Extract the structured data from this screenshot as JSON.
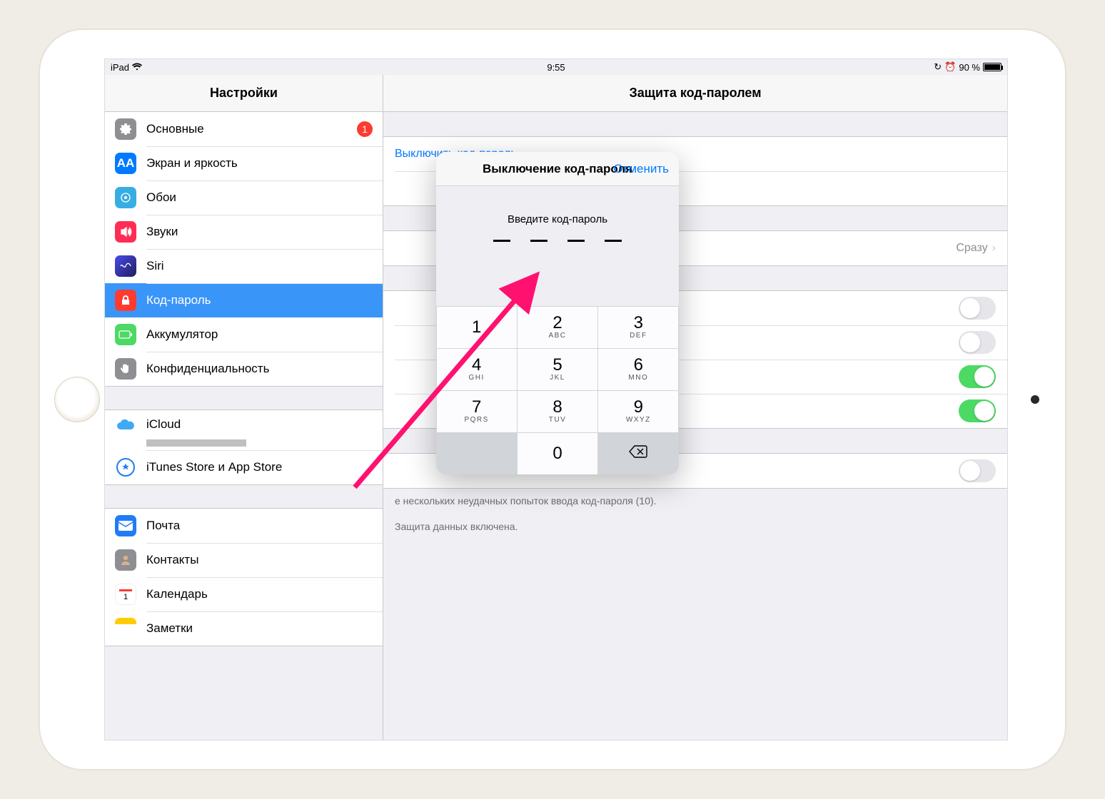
{
  "status": {
    "device": "iPad",
    "time": "9:55",
    "battery_pct": "90 %"
  },
  "titles": {
    "sidebar": "Настройки",
    "detail": "Защита код-паролем"
  },
  "sidebar": {
    "g1": [
      {
        "label": "Основные",
        "icon": "general",
        "badge": "1"
      },
      {
        "label": "Экран и яркость",
        "icon": "display"
      },
      {
        "label": "Обои",
        "icon": "wall"
      },
      {
        "label": "Звуки",
        "icon": "sound"
      },
      {
        "label": "Siri",
        "icon": "siri"
      },
      {
        "label": "Код-пароль",
        "icon": "pass",
        "selected": true
      },
      {
        "label": "Аккумулятор",
        "icon": "batt"
      },
      {
        "label": "Конфиденциальность",
        "icon": "priv"
      }
    ],
    "g2": [
      {
        "label": "iCloud",
        "icon": "icloud"
      },
      {
        "label": "iTunes Store и App Store",
        "icon": "itunes"
      }
    ],
    "g3": [
      {
        "label": "Почта",
        "icon": "mail"
      },
      {
        "label": "Контакты",
        "icon": "contacts"
      },
      {
        "label": "Календарь",
        "icon": "cal"
      },
      {
        "label": "Заметки",
        "icon": "notes"
      }
    ]
  },
  "detail": {
    "turn_off": "Выключить код-пароль",
    "require_value": "Сразу",
    "footer_erase": "e нескольких неудачных попыток ввода код-пароля (10).",
    "footer_protect": "Защита данных включена."
  },
  "popover": {
    "title": "Выключение код-пароля",
    "cancel": "Отменить",
    "prompt": "Введите код-пароль",
    "keys": [
      [
        "1",
        ""
      ],
      [
        "2",
        "ABC"
      ],
      [
        "3",
        "DEF"
      ],
      [
        "4",
        "GHI"
      ],
      [
        "5",
        "JKL"
      ],
      [
        "6",
        "MNO"
      ],
      [
        "7",
        "PQRS"
      ],
      [
        "8",
        "TUV"
      ],
      [
        "9",
        "WXYZ"
      ],
      [
        "",
        ""
      ],
      [
        "0",
        ""
      ],
      [
        "<x",
        ""
      ]
    ]
  }
}
